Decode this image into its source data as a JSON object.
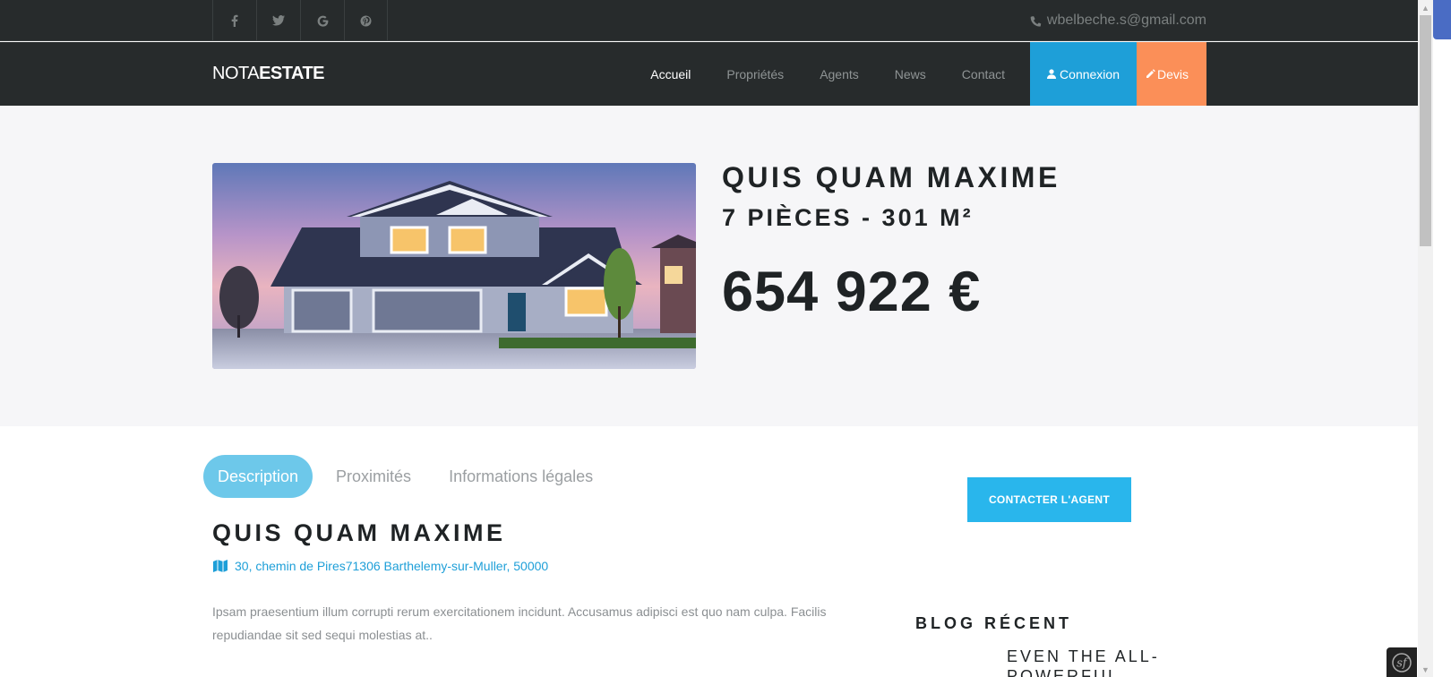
{
  "topbar": {
    "social": [
      {
        "name": "facebook",
        "icon": "facebook-icon"
      },
      {
        "name": "twitter",
        "icon": "twitter-icon"
      },
      {
        "name": "google",
        "icon": "google-icon"
      },
      {
        "name": "pinterest",
        "icon": "pinterest-icon"
      }
    ],
    "email": "wbelbeche.s@gmail.com",
    "email_icon": "phone-icon"
  },
  "navbar": {
    "brand_light": "NOTA",
    "brand_bold": "ESTATE",
    "items": [
      {
        "label": "Accueil",
        "active": true
      },
      {
        "label": "Propriétés",
        "active": false
      },
      {
        "label": "Agents",
        "active": false
      },
      {
        "label": "News",
        "active": false
      },
      {
        "label": "Contact",
        "active": false
      }
    ],
    "login_label": "Connexion",
    "devis_label": "Devis"
  },
  "hero": {
    "title": "QUIS QUAM MAXIME",
    "subtitle": "7 PIÈCES - 301 M²",
    "price": "654 922 €"
  },
  "tabs": [
    {
      "label": "Description",
      "active": true
    },
    {
      "label": "Proximités",
      "active": false
    },
    {
      "label": "Informations légales",
      "active": false
    }
  ],
  "property": {
    "title": "QUIS QUAM MAXIME",
    "address": "30, chemin de Pires71306 Barthelemy-sur-Muller, 50000",
    "description": "Ipsam praesentium illum corrupti rerum exercitationem incidunt. Accusamus adipisci est quo nam culpa. Facilis repudiandae sit sed sequi molestias at.."
  },
  "sidebar": {
    "contact_label": "CONTACTER L'AGENT",
    "blog_title": "BLOG RÉCENT",
    "blog_post_title": "EVEN THE ALL-POWERFUL"
  },
  "colors": {
    "dark_bg": "#272b2c",
    "accent_blue": "#1e9fd8",
    "accent_orange": "#fb8f58",
    "tab_active": "#6dc8ea",
    "hero_bg": "#f6f6f8"
  }
}
